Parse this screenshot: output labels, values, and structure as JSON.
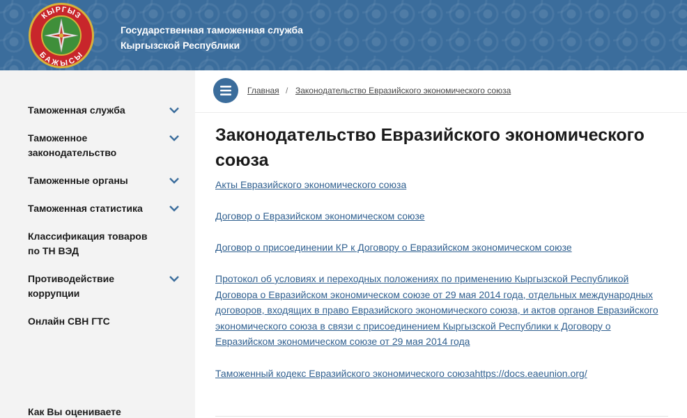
{
  "header": {
    "title_line1": "Государственная таможенная служба",
    "title_line2": "Кыргызской Республики",
    "logo_text_top": "КЫРГЫЗ",
    "logo_text_bottom": "БАЖЫСЫ",
    "bg_color": "#3b6d9c"
  },
  "sidebar": {
    "items": [
      {
        "label": "Таможенная служба",
        "expandable": true
      },
      {
        "label": "Таможенное законодательство",
        "expandable": true
      },
      {
        "label": "Таможенные органы",
        "expandable": true
      },
      {
        "label": "Таможенная статистика",
        "expandable": true
      },
      {
        "label": "Классификация товаров по ТН ВЭД",
        "expandable": false
      },
      {
        "label": "Противодействие коррупции",
        "expandable": true
      },
      {
        "label": "Онлайн СВН ГТС",
        "expandable": false
      }
    ],
    "rating_prompt": "Как Вы оцениваете"
  },
  "breadcrumbs": {
    "home": "Главная",
    "separator": "/",
    "current": "Законодательство Евразийского экономического союза"
  },
  "page": {
    "title": "Законодательство Евразийского экономического союза",
    "links": [
      "Акты Евразийского экономического союза",
      "Договор о Евразийском экономическом союзе",
      "Договор о присоединении КР к Договору о Евразийском экономическом союзе",
      "Протокол об условиях и переходных положениях по применению Кыргызской Республикой Договора о Евразийском экономическом союзе от 29 мая 2014 года, отдельных международных договоров, входящих в право Евразийского экономического союза, и актов органов Евразийского экономического союза в связи с присоединением Кыргызской Республики к Договору о Евразийском экономическом союзе от 29 мая 2014 года",
      "Таможенный кодекс Евразийского экономического союзаhttps://docs.eaeunion.org/"
    ]
  },
  "colors": {
    "accent": "#3b6d9c",
    "link": "#2f5f8f",
    "sidebar_bg": "#f3f3f3"
  }
}
